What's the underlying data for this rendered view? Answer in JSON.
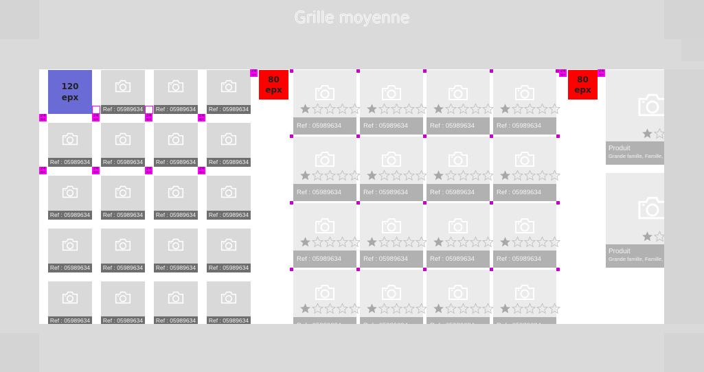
{
  "page": {
    "title": "Grille moyenne"
  },
  "markers": {
    "spacing_value": "24",
    "spacing_unit": "epx"
  },
  "blocks": {
    "large_margin": {
      "value": "120",
      "unit": "epx",
      "color": "#6b6bd6"
    },
    "medium_margin": {
      "value": "80",
      "unit": "epx",
      "color": "#ff0000"
    },
    "right_margin": {
      "value": "80",
      "unit": "epx",
      "color": "#ff0000"
    }
  },
  "small_grid": {
    "rows": 5,
    "cols": 4,
    "ref_label": "Ref : 05989634",
    "icon": "camera-icon",
    "tile_color": "#d9d9d9",
    "label_bg": "#6e6e6e"
  },
  "medium_grid": {
    "rows": 4,
    "cols": 4,
    "ref_label": "Ref : 05989634",
    "icon": "camera-icon",
    "rating": 1,
    "rating_max": 5,
    "tile_color": "#ebebeb",
    "label_bg": "#b1b1b1"
  },
  "large_grid": {
    "items": [
      {
        "name": "Produit",
        "category": "Grande famille, Famille, Sous famille.",
        "rating": 1,
        "rating_max": 5
      },
      {
        "name": "Produit",
        "category": "Grande famille, Famille, Sous famille.",
        "rating": 1,
        "rating_max": 5
      }
    ],
    "icon": "camera-icon"
  },
  "colors": {
    "background": "#dadada",
    "canvas": "#ffffff",
    "marker": "#ff00ff"
  }
}
